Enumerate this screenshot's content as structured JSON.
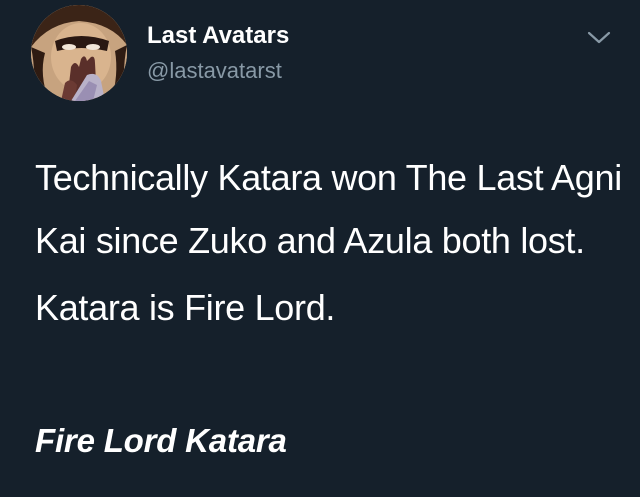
{
  "author": {
    "display_name": "Last Avatars",
    "handle": "@lastavatarst",
    "avatar_icon": "avatar-image"
  },
  "menu": {
    "icon": "chevron-down-icon"
  },
  "tweet": {
    "paragraphs": [
      "Technically Katara won The Last Agni Kai since Zuko and Azula both lost.",
      "Katara is Fire Lord."
    ]
  },
  "caption": "Fire Lord Katara",
  "colors": {
    "background": "#15202b",
    "text": "#ffffff",
    "secondary_text": "#8899a6"
  }
}
